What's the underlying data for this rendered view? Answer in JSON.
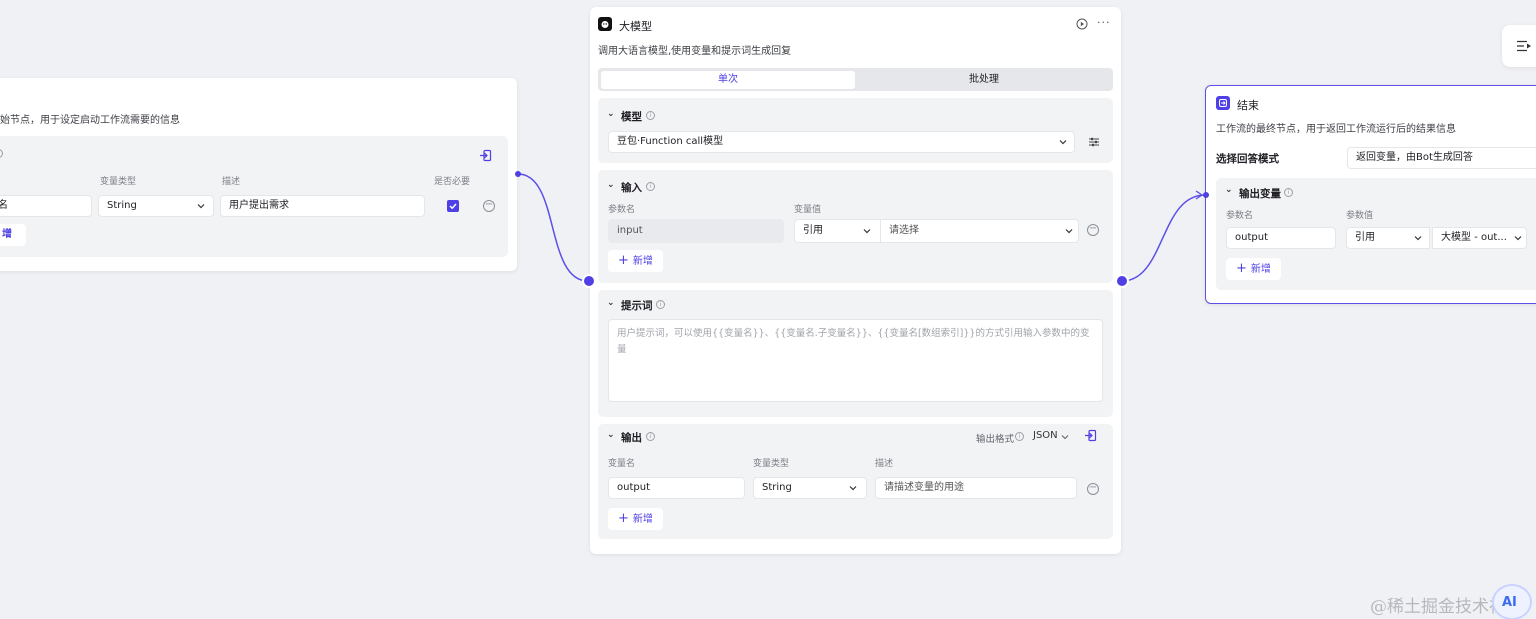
{
  "start_node": {
    "description": "始节点，用于设定启动工作流需要的信息",
    "col_type": "变量类型",
    "col_desc": "描述",
    "col_required": "是否必要",
    "var_name": "量名",
    "var_type": "String",
    "var_desc": "用户提出需求",
    "add_partial": "增"
  },
  "llm_node": {
    "title": "大模型",
    "description": "调用大语言模型,使用变量和提示词生成回复",
    "tab_single": "单次",
    "tab_batch": "批处理",
    "model_section": "模型",
    "model_value": "豆包·Function call模型",
    "input_section": "输入",
    "input_col_param": "参数名",
    "input_col_value": "变量值",
    "input_param": "input",
    "input_ref": "引用",
    "input_select_placeholder": "请选择",
    "add_label": "新增",
    "prompt_section": "提示词",
    "prompt_placeholder": "用户提示词，可以使用{{变量名}}、{{变量名.子变量名}}、{{变量名[数组索引]}}的方式引用输入参数中的变量",
    "output_section": "输出",
    "output_format_label": "输出格式",
    "output_format_value": "JSON",
    "output_col_name": "变量名",
    "output_col_type": "变量类型",
    "output_col_desc": "描述",
    "output_name": "output",
    "output_type": "String",
    "output_desc_placeholder": "请描述变量的用途"
  },
  "end_node": {
    "title": "结束",
    "description": "工作流的最终节点，用于返回工作流运行后的结果信息",
    "mode_label": "选择回答模式",
    "mode_value": "返回变量，由Bot生成回答",
    "output_section": "输出变量",
    "col_param": "参数名",
    "col_value": "参数值",
    "param_name": "output",
    "param_ref": "引用",
    "param_value": "大模型 - out...",
    "add_label": "新增"
  },
  "watermark": "@稀土掘金技术社区",
  "colors": {
    "accent": "#4e40e5",
    "canvas": "#f0f1f5"
  }
}
